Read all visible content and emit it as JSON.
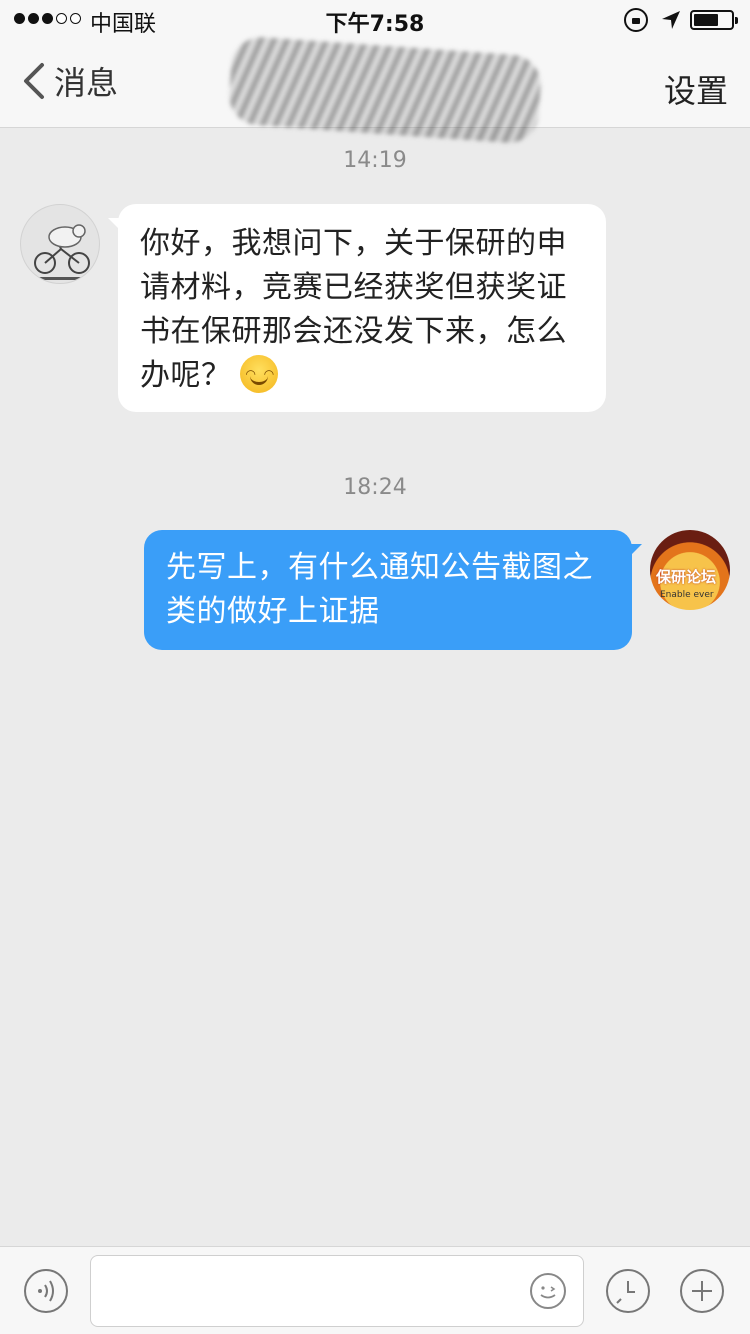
{
  "status_bar": {
    "carrier": "中国联",
    "time": "下午7:58",
    "battery_level": 0.6,
    "signal_bars_filled": 3,
    "signal_bars_total": 5
  },
  "nav": {
    "back_label": "消息",
    "title": "",
    "settings_label": "设置"
  },
  "messages": [
    {
      "timestamp": "14:19",
      "direction": "incoming",
      "text": "你好，我想问下，关于保研的申请材料，竞赛已经获奖但获奖证书在保研那会还没发下来，怎么办呢？",
      "emoji": "smile-icon"
    },
    {
      "timestamp": "18:24",
      "direction": "outgoing",
      "text": "先写上，有什么通知公告截图之类的做好上证据",
      "avatar_text": "保研论坛",
      "avatar_subtext": "Enable ever"
    }
  ],
  "input": {
    "placeholder": "",
    "value": ""
  },
  "colors": {
    "outgoing_bubble": "#3a9ef8",
    "incoming_bubble": "#ffffff",
    "background": "#ebebeb"
  }
}
